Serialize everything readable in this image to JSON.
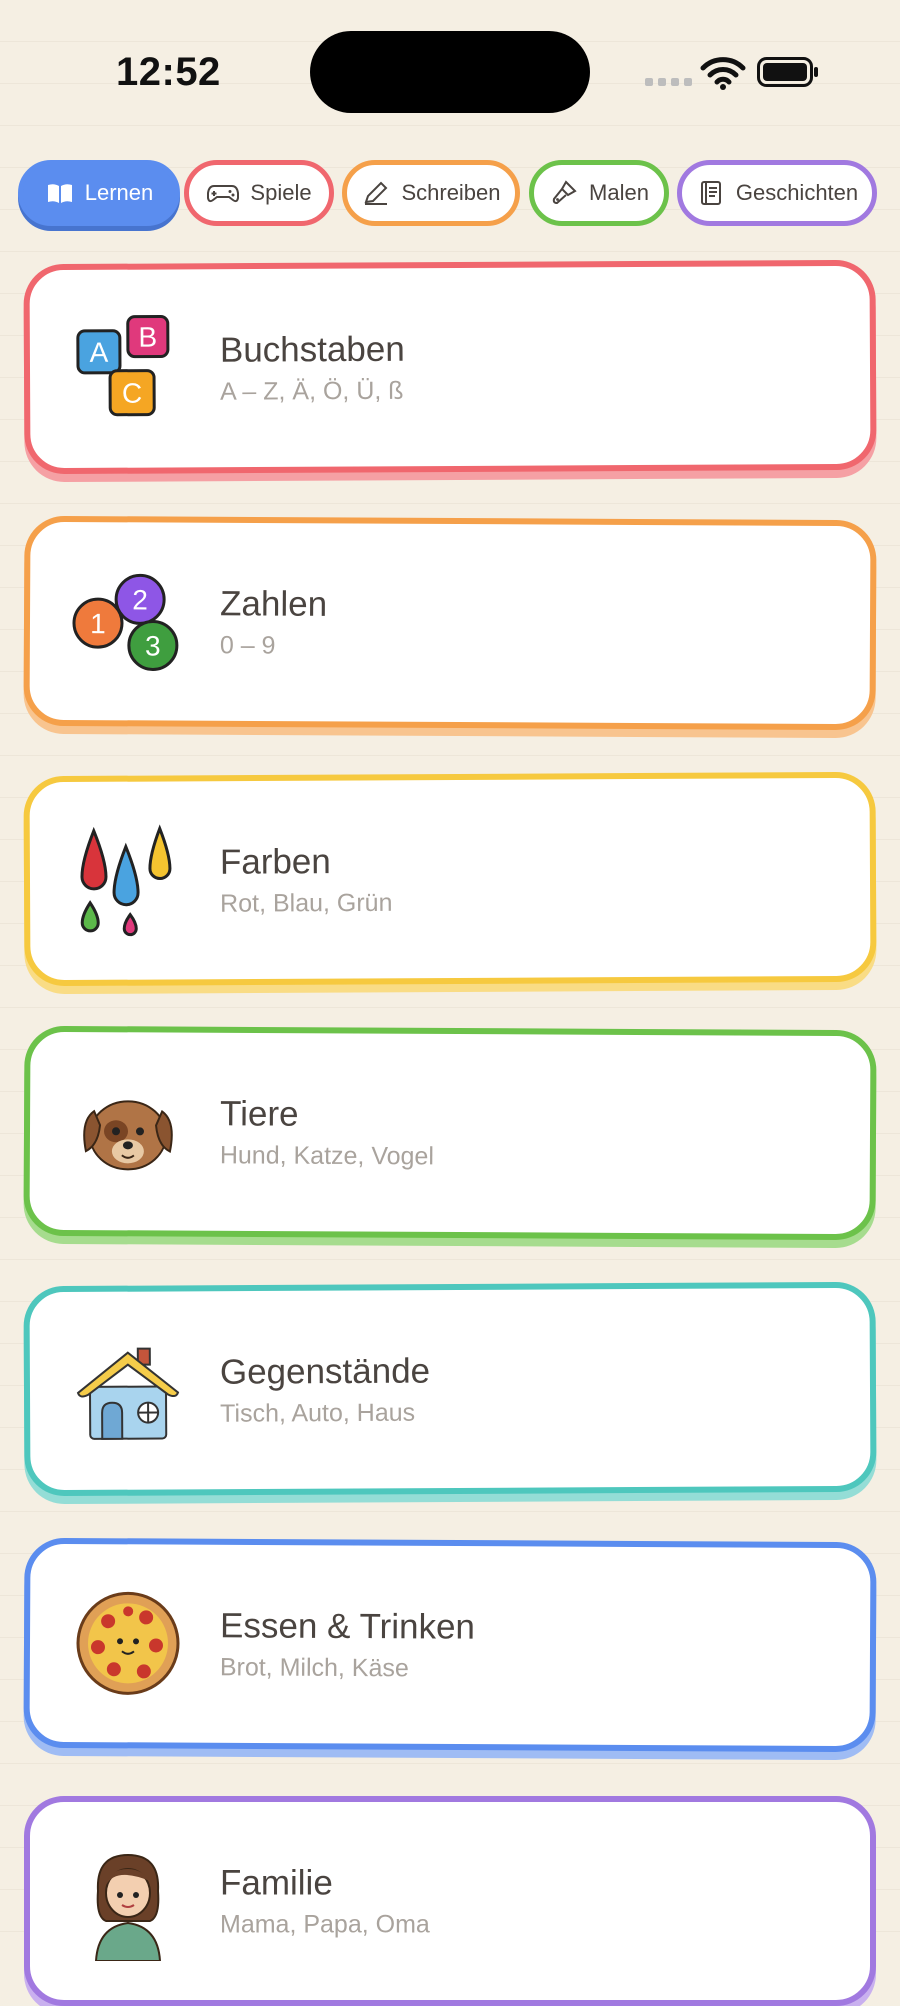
{
  "status_bar": {
    "time": "12:52"
  },
  "tabs": [
    {
      "label": "Lernen",
      "icon": "book-open-icon",
      "active": true,
      "color": "#5b8def"
    },
    {
      "label": "Spiele",
      "icon": "gamepad-icon",
      "active": false,
      "color": "#f0676e"
    },
    {
      "label": "Schreiben",
      "icon": "pencil-icon",
      "active": false,
      "color": "#f5a04a"
    },
    {
      "label": "Malen",
      "icon": "paintbrush-icon",
      "active": false,
      "color": "#6cc24a"
    },
    {
      "label": "Geschichten",
      "icon": "book-icon",
      "active": false,
      "color": "#a179e0"
    }
  ],
  "categories": [
    {
      "title": "Buchstaben",
      "subtitle": "A – Z, Ä, Ö, Ü, ß",
      "icon": "letter-blocks-icon",
      "color": "#f0676e"
    },
    {
      "title": "Zahlen",
      "subtitle": "0 – 9",
      "icon": "number-balls-icon",
      "color": "#f5a04a"
    },
    {
      "title": "Farben",
      "subtitle": "Rot, Blau, Grün",
      "icon": "paint-drops-icon",
      "color": "#f6c93f"
    },
    {
      "title": "Tiere",
      "subtitle": "Hund, Katze, Vogel",
      "icon": "dog-icon",
      "color": "#6cc24a"
    },
    {
      "title": "Gegenstände",
      "subtitle": "Tisch, Auto, Haus",
      "icon": "house-icon",
      "color": "#4ec7bd"
    },
    {
      "title": "Essen & Trinken",
      "subtitle": "Brot, Milch, Käse",
      "icon": "pizza-icon",
      "color": "#5b8def"
    },
    {
      "title": "Familie",
      "subtitle": "Mama, Papa, Oma",
      "icon": "girl-icon",
      "color": "#a179e0"
    }
  ]
}
